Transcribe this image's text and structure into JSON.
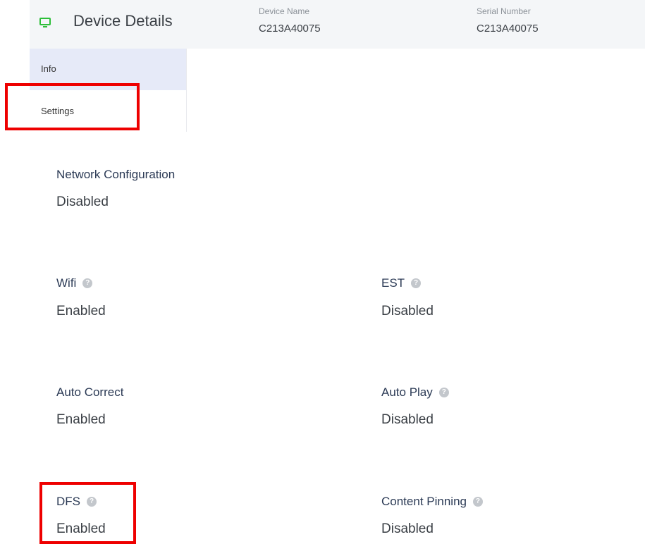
{
  "header": {
    "title": "Device Details",
    "device_name_label": "Device Name",
    "device_name_value": "C213A40075",
    "serial_number_label": "Serial Number",
    "serial_number_value": "C213A40075"
  },
  "nav": {
    "items": [
      {
        "label": "Info",
        "active": true
      },
      {
        "label": "Settings",
        "active": false
      }
    ]
  },
  "settings": {
    "network_configuration": {
      "label": "Network Configuration",
      "value": "Disabled"
    },
    "wifi": {
      "label": "Wifi",
      "value": "Enabled"
    },
    "est": {
      "label": "EST",
      "value": "Disabled"
    },
    "auto_correct": {
      "label": "Auto Correct",
      "value": "Enabled"
    },
    "auto_play": {
      "label": "Auto Play",
      "value": "Disabled"
    },
    "dfs": {
      "label": "DFS",
      "value": "Enabled"
    },
    "content_pinning": {
      "label": "Content Pinning",
      "value": "Disabled"
    }
  },
  "help_icon_glyph": "?",
  "colors": {
    "highlight": "#ee0000",
    "monitor_icon": "#2dbf3a",
    "active_nav": "#e6eaf8",
    "label_text": "#2b3a55"
  }
}
